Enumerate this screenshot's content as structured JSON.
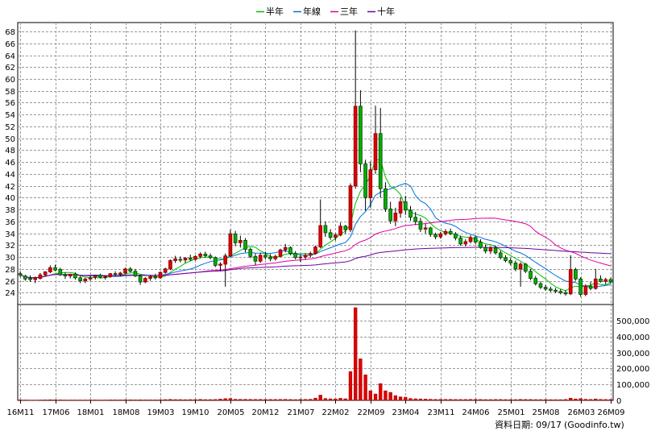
{
  "chart_data": {
    "type": "candlestick",
    "legend": {
      "placement": "top-center",
      "items": [
        {
          "name": "半年",
          "color": "#00c000"
        },
        {
          "name": "年線",
          "color": "#0070e0"
        },
        {
          "name": "三年",
          "color": "#e000a0"
        },
        {
          "name": "十年",
          "color": "#7000a0"
        }
      ]
    },
    "grid": true,
    "price_axis": {
      "range": [
        22,
        69.5
      ],
      "ticks": [
        24,
        26,
        28,
        30,
        32,
        34,
        36,
        38,
        40,
        42,
        44,
        46,
        48,
        50,
        52,
        54,
        56,
        58,
        60,
        62,
        64,
        66,
        68
      ]
    },
    "volume_axis": {
      "range": [
        0,
        600000
      ],
      "ticks": [
        0,
        100000,
        200000,
        300000,
        400000,
        500000
      ],
      "tick_labels": [
        "0",
        "100,000",
        "200,000",
        "300,000",
        "400,000",
        "500,000"
      ]
    },
    "x_axis": {
      "months": 119,
      "tick_labels": [
        "16M11",
        "17M06",
        "18M01",
        "18M08",
        "19M03",
        "19M10",
        "20M05",
        "20M12",
        "21M07",
        "22M02",
        "22M09",
        "23M04",
        "23M11",
        "24M06",
        "25M01",
        "25M08",
        "26M03",
        "26M09"
      ],
      "tick_index": [
        0,
        7,
        14,
        21,
        28,
        35,
        42,
        49,
        56,
        63,
        70,
        77,
        84,
        91,
        98,
        105,
        112,
        118
      ]
    },
    "colors": {
      "up": "#e00000",
      "down": "#00b000",
      "up_edge": "#800000",
      "down_edge": "#004000"
    },
    "ohlc": [
      [
        27.2,
        27.6,
        26.6,
        27.0
      ],
      [
        26.8,
        27.0,
        26.0,
        26.3
      ],
      [
        26.4,
        26.9,
        25.8,
        26.2
      ],
      [
        26.2,
        26.7,
        25.6,
        26.5
      ],
      [
        26.4,
        27.3,
        26.2,
        27.0
      ],
      [
        27.0,
        27.6,
        26.7,
        27.5
      ],
      [
        27.5,
        28.6,
        27.3,
        28.2
      ],
      [
        28.2,
        28.7,
        27.6,
        27.8
      ],
      [
        27.9,
        28.2,
        26.8,
        27.0
      ],
      [
        27.0,
        27.4,
        26.3,
        26.8
      ],
      [
        26.8,
        27.2,
        26.4,
        27.1
      ],
      [
        27.1,
        27.4,
        26.2,
        26.5
      ],
      [
        26.5,
        26.8,
        25.6,
        26.0
      ],
      [
        26.0,
        26.5,
        25.6,
        26.3
      ],
      [
        26.3,
        26.8,
        26.0,
        26.5
      ],
      [
        26.6,
        27.0,
        26.2,
        26.9
      ],
      [
        26.9,
        27.2,
        26.4,
        26.6
      ],
      [
        26.6,
        26.9,
        26.2,
        26.7
      ],
      [
        26.7,
        27.3,
        26.5,
        27.2
      ],
      [
        27.2,
        27.6,
        26.8,
        27.1
      ],
      [
        27.1,
        27.5,
        26.7,
        27.3
      ],
      [
        27.3,
        28.2,
        27.1,
        28.0
      ],
      [
        28.0,
        28.3,
        27.4,
        27.6
      ],
      [
        27.6,
        28.0,
        26.6,
        26.8
      ],
      [
        26.8,
        27.0,
        25.3,
        25.8
      ],
      [
        25.8,
        26.6,
        25.6,
        26.4
      ],
      [
        26.4,
        27.0,
        26.0,
        26.7
      ],
      [
        26.7,
        27.2,
        26.2,
        26.5
      ],
      [
        26.5,
        27.6,
        26.3,
        27.4
      ],
      [
        27.4,
        28.2,
        27.2,
        28.0
      ],
      [
        28.0,
        29.6,
        27.8,
        29.4
      ],
      [
        29.4,
        30.2,
        29.0,
        29.7
      ],
      [
        29.6,
        30.1,
        29.1,
        29.5
      ],
      [
        29.5,
        30.0,
        29.0,
        29.8
      ],
      [
        29.8,
        30.4,
        29.3,
        29.6
      ],
      [
        29.6,
        30.3,
        29.4,
        30.1
      ],
      [
        30.1,
        30.8,
        29.8,
        30.5
      ],
      [
        30.5,
        30.9,
        29.9,
        30.2
      ],
      [
        30.2,
        30.6,
        29.6,
        29.9
      ],
      [
        29.9,
        30.1,
        28.3,
        28.6
      ],
      [
        28.6,
        29.1,
        27.6,
        28.8
      ],
      [
        28.8,
        30.6,
        25.0,
        30.2
      ],
      [
        30.2,
        34.6,
        30.0,
        33.9
      ],
      [
        33.9,
        34.4,
        31.8,
        32.4
      ],
      [
        32.4,
        33.6,
        31.6,
        32.8
      ],
      [
        32.8,
        33.2,
        30.8,
        31.3
      ],
      [
        31.3,
        31.6,
        29.8,
        30.1
      ],
      [
        30.1,
        30.6,
        28.6,
        29.3
      ],
      [
        29.3,
        30.7,
        29.0,
        30.3
      ],
      [
        30.3,
        30.9,
        29.6,
        30.0
      ],
      [
        30.0,
        30.5,
        29.3,
        29.7
      ],
      [
        29.7,
        30.4,
        29.4,
        30.1
      ],
      [
        30.1,
        31.4,
        30.0,
        31.2
      ],
      [
        31.2,
        32.2,
        30.8,
        31.6
      ],
      [
        31.6,
        31.8,
        30.3,
        30.6
      ],
      [
        30.6,
        31.0,
        29.6,
        29.9
      ],
      [
        29.9,
        30.4,
        29.2,
        30.0
      ],
      [
        30.0,
        30.6,
        29.6,
        30.3
      ],
      [
        30.3,
        30.9,
        29.9,
        30.6
      ],
      [
        30.6,
        31.9,
        30.4,
        31.7
      ],
      [
        31.7,
        39.7,
        31.5,
        35.3
      ],
      [
        35.3,
        36.0,
        33.4,
        34.1
      ],
      [
        34.1,
        34.7,
        32.9,
        33.3
      ],
      [
        33.3,
        34.0,
        32.8,
        33.7
      ],
      [
        33.7,
        35.8,
        33.5,
        35.2
      ],
      [
        35.2,
        35.4,
        33.9,
        34.6
      ],
      [
        34.6,
        42.4,
        34.2,
        42.0
      ],
      [
        42.0,
        68.2,
        41.5,
        55.4
      ],
      [
        55.4,
        58.1,
        44.3,
        45.7
      ],
      [
        45.7,
        46.4,
        37.8,
        40.0
      ],
      [
        40.0,
        46.1,
        38.3,
        44.7
      ],
      [
        44.7,
        55.5,
        44.0,
        50.8
      ],
      [
        50.8,
        55.1,
        40.0,
        41.5
      ],
      [
        41.5,
        42.6,
        37.6,
        38.1
      ],
      [
        38.1,
        39.3,
        35.6,
        36.1
      ],
      [
        36.1,
        38.3,
        35.2,
        37.4
      ],
      [
        37.4,
        40.1,
        36.6,
        39.3
      ],
      [
        39.3,
        40.3,
        37.1,
        37.9
      ],
      [
        37.9,
        38.6,
        36.1,
        36.7
      ],
      [
        36.7,
        37.6,
        35.4,
        36.0
      ],
      [
        36.0,
        36.6,
        34.2,
        34.7
      ],
      [
        34.7,
        35.6,
        33.9,
        34.9
      ],
      [
        34.9,
        35.1,
        33.4,
        33.8
      ],
      [
        33.8,
        34.1,
        33.0,
        33.4
      ],
      [
        33.4,
        34.2,
        33.1,
        33.9
      ],
      [
        33.9,
        34.7,
        33.6,
        34.3
      ],
      [
        34.3,
        34.8,
        33.7,
        33.9
      ],
      [
        33.9,
        34.2,
        32.8,
        33.2
      ],
      [
        33.2,
        33.6,
        31.9,
        32.2
      ],
      [
        32.2,
        33.0,
        31.8,
        32.6
      ],
      [
        32.6,
        33.7,
        32.3,
        33.3
      ],
      [
        33.3,
        33.6,
        32.2,
        32.5
      ],
      [
        32.5,
        33.0,
        31.4,
        31.6
      ],
      [
        31.6,
        32.1,
        30.6,
        31.0
      ],
      [
        31.0,
        31.8,
        30.5,
        31.5
      ],
      [
        31.5,
        31.9,
        30.4,
        30.7
      ],
      [
        30.7,
        31.1,
        29.6,
        29.9
      ],
      [
        29.9,
        30.3,
        29.1,
        29.4
      ],
      [
        29.4,
        29.8,
        28.6,
        29.0
      ],
      [
        29.0,
        29.4,
        27.6,
        28.0
      ],
      [
        28.0,
        29.1,
        25.0,
        28.8
      ],
      [
        28.8,
        29.0,
        27.3,
        27.6
      ],
      [
        27.6,
        28.0,
        26.1,
        26.4
      ],
      [
        26.4,
        26.8,
        25.2,
        25.5
      ],
      [
        25.5,
        25.9,
        24.6,
        24.9
      ],
      [
        24.9,
        25.3,
        24.3,
        24.6
      ],
      [
        24.6,
        25.0,
        24.1,
        24.4
      ],
      [
        24.4,
        24.8,
        23.9,
        24.2
      ],
      [
        24.2,
        24.6,
        23.7,
        24.0
      ],
      [
        24.0,
        24.4,
        23.5,
        23.8
      ],
      [
        23.8,
        30.3,
        23.6,
        27.9
      ],
      [
        27.9,
        28.2,
        26.0,
        26.3
      ],
      [
        26.3,
        26.6,
        23.3,
        23.7
      ],
      [
        23.7,
        25.4,
        23.4,
        25.1
      ],
      [
        25.1,
        25.8,
        24.4,
        24.7
      ],
      [
        24.7,
        28.0,
        24.5,
        26.3
      ],
      [
        26.3,
        26.9,
        25.7,
        25.9
      ],
      [
        25.9,
        26.5,
        25.4,
        26.2
      ],
      [
        26.2,
        26.5,
        25.5,
        25.8
      ]
    ],
    "volume": [
      3000,
      2500,
      2000,
      2000,
      2500,
      3000,
      4000,
      3500,
      3000,
      2500,
      2500,
      2500,
      2500,
      2500,
      2500,
      3000,
      2500,
      2500,
      3000,
      3000,
      3000,
      4000,
      3500,
      3000,
      3500,
      3000,
      3000,
      3000,
      3500,
      5000,
      6000,
      5000,
      5000,
      4500,
      5000,
      5000,
      6000,
      5000,
      5000,
      5500,
      8000,
      11000,
      12000,
      7000,
      6500,
      6500,
      6000,
      6000,
      6000,
      5500,
      5500,
      5500,
      6000,
      6500,
      5500,
      5000,
      6000,
      6000,
      7000,
      14000,
      33000,
      12000,
      10000,
      9000,
      13000,
      10000,
      180000,
      580000,
      260000,
      160000,
      60000,
      40000,
      105000,
      60000,
      50000,
      30000,
      22000,
      20000,
      12000,
      10000,
      9000,
      8000,
      7000,
      6000,
      6000,
      6000,
      6000,
      5500,
      5500,
      5500,
      6000,
      6000,
      5500,
      5000,
      5000,
      5500,
      5500,
      5000,
      5000,
      5000,
      6000,
      5500,
      5500,
      5000,
      5000,
      5000,
      4500,
      4500,
      4500,
      5500,
      14000,
      9000,
      11000,
      7000,
      6000,
      9000,
      6000,
      5500,
      5500
    ]
  },
  "footer": {
    "date_label": "資料日期: 09/17",
    "source": "(Goodinfo.tw)"
  }
}
